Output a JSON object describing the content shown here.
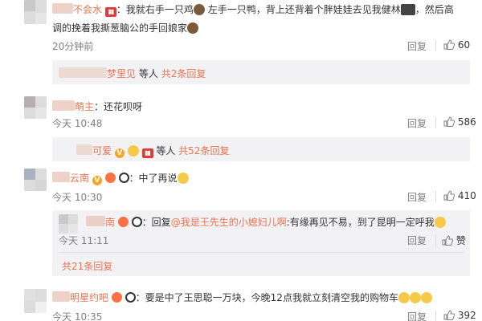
{
  "comment1": {
    "name_visible": "不会水",
    "text_a": "：我就右手一只鸡",
    "text_b": "左手一只鸭，背上还背着个胖娃娃去见我健林",
    "text_c": "，然后高",
    "text_line2": "调的挽着我撕葱脑公的手回娘家",
    "time": "20分钟前",
    "reply": "回复",
    "likes": "60",
    "sub_name_visible": "梦里见",
    "sub_text": "等人",
    "sub_more": "共2条回复"
  },
  "comment2": {
    "name_visible": "萌主",
    "text": "：还花呗呀",
    "time": "今天 10:48",
    "reply": "回复",
    "likes": "586",
    "sub_name_visible": "可爱",
    "sub_text": "等人",
    "sub_more": "共52条回复"
  },
  "comment3": {
    "name_visible": "云南",
    "text": "：中了再说",
    "time": "今天 10:30",
    "reply": "回复",
    "likes": "410",
    "sub_reply": {
      "name_visible": "南",
      "prefix": "：回复",
      "mention": "@我是王先生的小媳妇儿啊",
      "text": ":有缘再见不易，到了昆明一定呼我",
      "time": "今天 11:11",
      "reply": "回复",
      "likes": "赞"
    },
    "more": "共21条回复"
  },
  "comment4": {
    "name_visible": "明星约吧",
    "text": "：要是中了王思聪一万块，今晚12点我就立刻清空我的购物车",
    "time": "今天 10:35",
    "reply": "回复",
    "likes": "392"
  },
  "colors": {
    "accent": "#eb7350",
    "reply_bg": "#f2f2f5",
    "gray": "#808080"
  },
  "icons": [
    "thumbs-up-icon",
    "v-badge-icon",
    "panda-icon",
    "emoji-icon"
  ]
}
